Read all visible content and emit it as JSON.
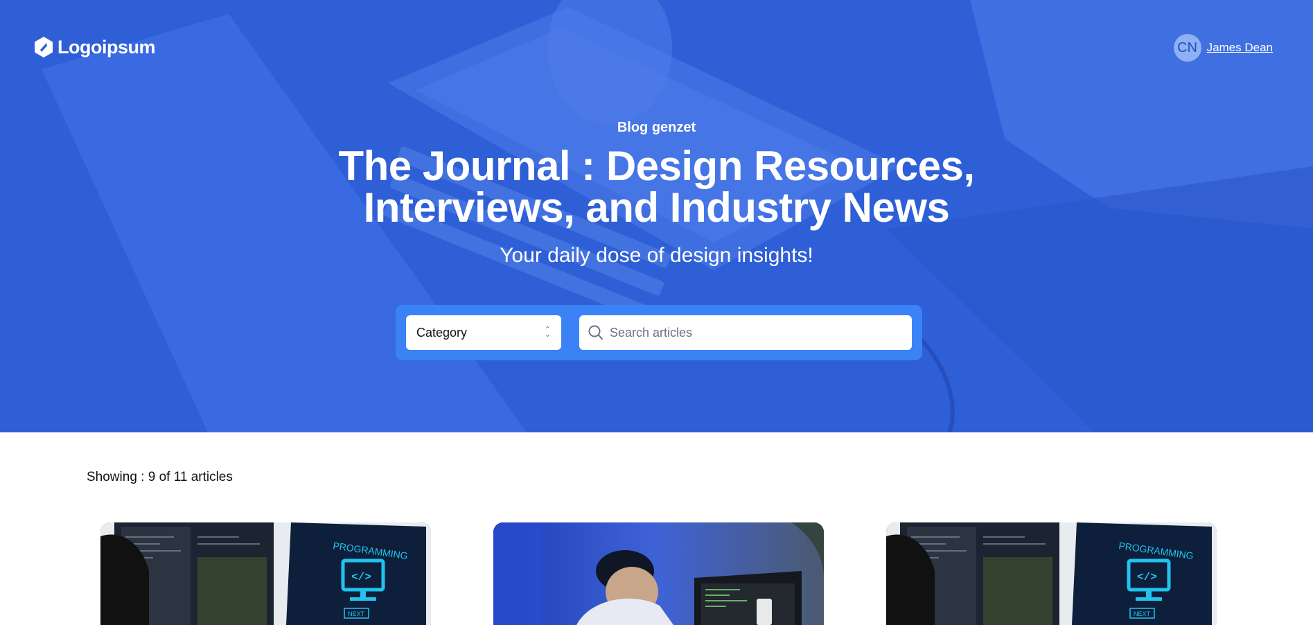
{
  "header": {
    "logo_text": "Logoipsum",
    "avatar_initials": "CN",
    "user_name": "James Dean"
  },
  "hero": {
    "eyebrow": "Blog genzet",
    "title_line1": "The Journal : Design Resources,",
    "title_line2": "Interviews, and Industry News",
    "subtitle": "Your daily dose of design insights!"
  },
  "filters": {
    "category_value": "Category",
    "search_placeholder": "Search articles"
  },
  "results": {
    "showing": "Showing : 9 of 11 articles"
  },
  "cards": [
    {
      "image": "programming-monitors",
      "screen_text": "PROGRAMMING",
      "button_text": "NEXT"
    },
    {
      "image": "developer-at-laptop"
    },
    {
      "image": "programming-monitors",
      "screen_text": "PROGRAMMING",
      "button_text": "NEXT"
    }
  ],
  "colors": {
    "hero_blue": "#2f5fd6",
    "search_bar_blue": "#3b82f6",
    "accent_cyan": "#22c3ee"
  }
}
